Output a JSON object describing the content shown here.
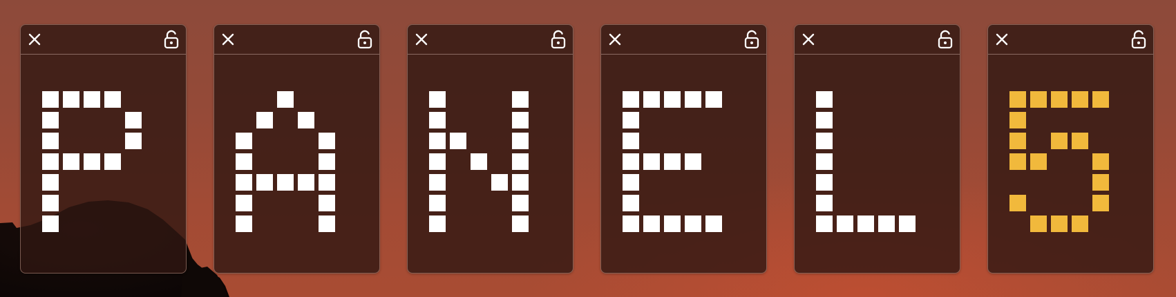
{
  "colors": {
    "pixel_default": "#ffffff",
    "pixel_accent": "#f1b93c",
    "panel_bg": "#301612"
  },
  "icons": {
    "close": "close-icon",
    "lock": "lock-open-icon"
  },
  "panels": [
    {
      "letter": "P",
      "color": "#ffffff",
      "grid": [
        "11110",
        "10001",
        "10001",
        "11110",
        "10000",
        "10000",
        "10000"
      ]
    },
    {
      "letter": "A",
      "color": "#ffffff",
      "grid": [
        "00100",
        "01010",
        "10001",
        "10001",
        "11111",
        "10001",
        "10001"
      ]
    },
    {
      "letter": "N",
      "color": "#ffffff",
      "grid": [
        "10001",
        "10001",
        "11001",
        "10101",
        "10011",
        "10001",
        "10001"
      ]
    },
    {
      "letter": "E",
      "color": "#ffffff",
      "grid": [
        "11111",
        "10000",
        "10000",
        "11110",
        "10000",
        "10000",
        "11111"
      ]
    },
    {
      "letter": "L",
      "color": "#ffffff",
      "grid": [
        "10000",
        "10000",
        "10000",
        "10000",
        "10000",
        "10000",
        "11111"
      ]
    },
    {
      "letter": "5",
      "color": "#f1b93c",
      "grid": [
        "11111",
        "10000",
        "10110",
        "11001",
        "00001",
        "10001",
        "01110"
      ]
    }
  ]
}
